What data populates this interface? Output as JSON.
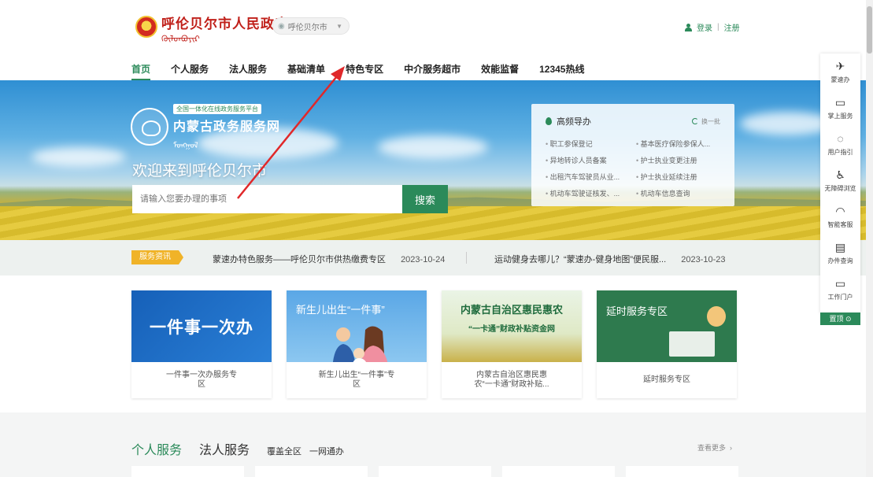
{
  "header": {
    "site_title": "呼伦贝尔市人民政府",
    "mongol_script": "ᠬᠥᠯᠦᠨᠪᠤᠶᠢᠷ",
    "city": "呼伦贝尔市",
    "login": "登录",
    "register": "注册"
  },
  "nav": [
    {
      "label": "首页",
      "active": true
    },
    {
      "label": "个人服务"
    },
    {
      "label": "法人服务"
    },
    {
      "label": "基础清单"
    },
    {
      "label": "特色专区"
    },
    {
      "label": "中介服务超市"
    },
    {
      "label": "效能监督"
    },
    {
      "label": "12345热线"
    }
  ],
  "banner": {
    "platform_tag": "全国一体化在线政务服务平台",
    "platform_name": "内蒙古政务服务网",
    "welcome": "欢迎来到呼伦贝尔市",
    "search_placeholder": "请输入您要办理的事项",
    "search_button": "搜索"
  },
  "guide": {
    "title": "高频导办",
    "refresh": "换一批",
    "items": [
      "职工参保登记",
      "基本医疗保险参保人...",
      "异地转诊人员备案",
      "护士执业变更注册",
      "出租汽车驾驶员从业...",
      "护士执业延续注册",
      "机动车驾驶证核发、...",
      "机动车信息查询"
    ]
  },
  "news": {
    "tag": "服务资讯",
    "items": [
      {
        "text": "蒙速办特色服务——呼伦贝尔市供热缴费专区",
        "date": "2023-10-24"
      },
      {
        "text": "运动健身去哪儿？“蒙速办-健身地图”便民服...",
        "date": "2023-10-23"
      }
    ]
  },
  "cards": [
    {
      "image_title": "一件事一次办",
      "caption": "一件事一次办服务专区"
    },
    {
      "image_title": "新生儿出生“一件事”",
      "caption": "新生儿出生“一件事”专区"
    },
    {
      "image_title": "内蒙古自治区惠民惠农",
      "image_sub": "“一卡通”财政补贴资金网",
      "caption": "内蒙古自治区惠民惠农“一卡通”财政补贴..."
    },
    {
      "image_title": "延时服务专区",
      "caption": "延时服务专区"
    }
  ],
  "services": {
    "tabs": [
      "个人服务",
      "法人服务"
    ],
    "subs": [
      "覆盖全区",
      "一网通办"
    ],
    "more": "查看更多"
  },
  "sidebar": [
    {
      "label": "蒙速办",
      "icon": "mengsuban-icon",
      "glyph": "✈"
    },
    {
      "label": "掌上服务",
      "icon": "mobile-icon",
      "glyph": "▭"
    },
    {
      "label": "用户指引",
      "icon": "bulb-icon",
      "glyph": "◌"
    },
    {
      "label": "无障碍浏览",
      "icon": "accessibility-icon",
      "glyph": "♿"
    },
    {
      "label": "智能客服",
      "icon": "headset-icon",
      "glyph": "◠"
    },
    {
      "label": "办件查询",
      "icon": "document-search-icon",
      "glyph": "▤"
    },
    {
      "label": "工作门户",
      "icon": "monitor-icon",
      "glyph": "▭"
    }
  ],
  "top_button": "置顶",
  "colors": {
    "brand_green": "#2b8a5a",
    "title_red": "#c0201a",
    "news_tag": "#f0b328",
    "annotation_arrow": "#e0282a"
  }
}
